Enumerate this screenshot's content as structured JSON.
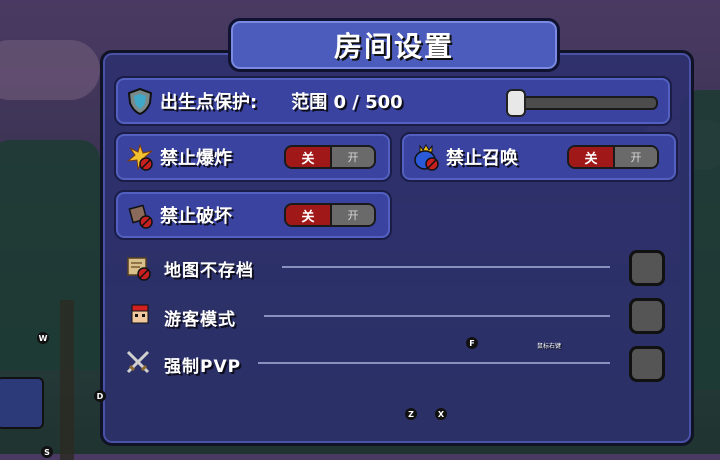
{
  "title": "房间设置",
  "spawn_protection": {
    "label": "出生点保护:",
    "range_text": "范围 0 / 500",
    "value": 0,
    "max": 500
  },
  "toggles": [
    {
      "label": "禁止爆炸",
      "off": "关",
      "on": "开",
      "state": "off"
    },
    {
      "label": "禁止召唤",
      "off": "关",
      "on": "开",
      "state": "off"
    },
    {
      "label": "禁止破坏",
      "off": "关",
      "on": "开",
      "state": "off"
    }
  ],
  "checkboxes": [
    {
      "label": "地图不存档",
      "checked": false
    },
    {
      "label": "游客模式",
      "checked": false
    },
    {
      "label": "强制PVP",
      "checked": false
    }
  ],
  "key_hints": {
    "w": "W",
    "d": "D",
    "s": "S",
    "f": "F",
    "z": "Z",
    "x": "X",
    "right_click": "鼠标右键"
  },
  "colors": {
    "panel": "#2c306e",
    "title_box": "#4b5cbc",
    "toggle_off": "#a01818"
  }
}
